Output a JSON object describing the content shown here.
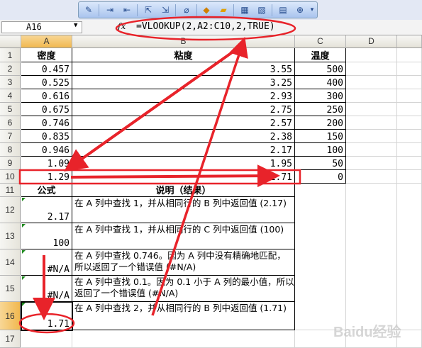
{
  "formula_bar": {
    "cell_ref": "A16",
    "fx": "fx",
    "formula": "=VLOOKUP(2,A2:C10,2,TRUE)"
  },
  "columns": [
    "A",
    "B",
    "C",
    "D"
  ],
  "rows": [
    "1",
    "2",
    "3",
    "4",
    "5",
    "6",
    "7",
    "8",
    "9",
    "10",
    "11",
    "12",
    "13",
    "14",
    "15",
    "16",
    "17"
  ],
  "headers": {
    "a": "密度",
    "b": "粘度",
    "c": "温度"
  },
  "data": [
    {
      "a": "0.457",
      "b": "3.55",
      "c": "500"
    },
    {
      "a": "0.525",
      "b": "3.25",
      "c": "400"
    },
    {
      "a": "0.616",
      "b": "2.93",
      "c": "300"
    },
    {
      "a": "0.675",
      "b": "2.75",
      "c": "250"
    },
    {
      "a": "0.746",
      "b": "2.57",
      "c": "200"
    },
    {
      "a": "0.835",
      "b": "2.38",
      "c": "150"
    },
    {
      "a": "0.946",
      "b": "2.17",
      "c": "100"
    },
    {
      "a": "1.09",
      "b": "1.95",
      "c": "50"
    },
    {
      "a": "1.29",
      "b": "1.71",
      "c": "0"
    }
  ],
  "table2": {
    "header_a": "公式",
    "header_b": "说明（结果）",
    "rows": [
      {
        "result": "2.17",
        "desc": "在 A 列中查找 1，并从相同行的 B 列中返回值 (2.17)"
      },
      {
        "result": "100",
        "desc": "在 A 列中查找 1，并从相同行的 C 列中返回值 (100)"
      },
      {
        "result": "#N/A",
        "desc": "在 A 列中查找 0.746。因为 A 列中没有精确地匹配，所以返回了一个错误值 (#N/A)"
      },
      {
        "result": "#N/A",
        "desc": "在 A 列中查找 0.1。因为 0.1 小于 A 列的最小值，所以返回了一个错误值 (#N/A)"
      },
      {
        "result": "1.71",
        "desc": "在 A 列中查找 2，并从相同行的 B 列中返回值 (1.71)"
      }
    ]
  },
  "watermark": "Baidu经验",
  "colors": {
    "annotation": "#e8232a",
    "selected_header": "#f4c262"
  }
}
